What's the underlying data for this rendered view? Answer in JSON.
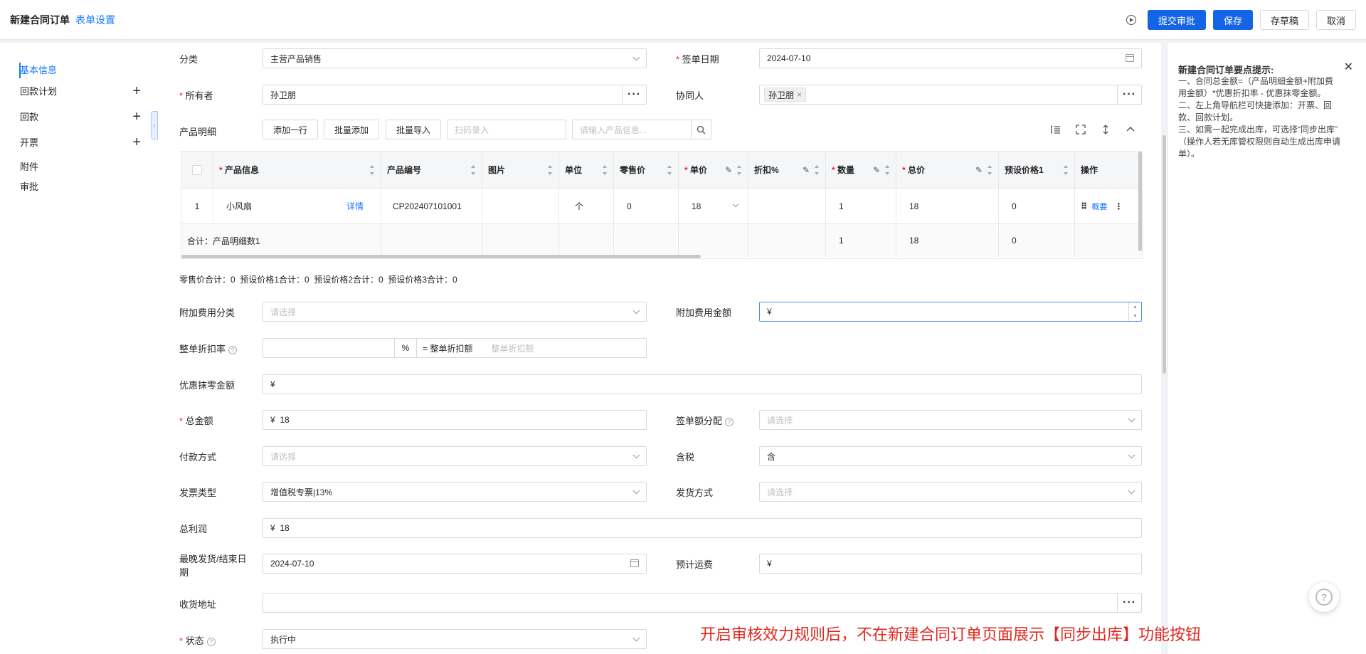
{
  "header": {
    "title": "新建合同订单",
    "form_setting": "表单设置",
    "buttons": {
      "submit": "提交审批",
      "save": "保存",
      "draft": "存草稿",
      "cancel": "取消"
    }
  },
  "nav": {
    "items": [
      {
        "label": "基本信息"
      },
      {
        "label": "回款计划"
      },
      {
        "label": "回款"
      },
      {
        "label": "开票"
      },
      {
        "label": "附件"
      },
      {
        "label": "审批"
      }
    ]
  },
  "form": {
    "category": {
      "label": "分类",
      "value": "主营产品销售"
    },
    "sign_date": {
      "label": "签单日期",
      "value": "2024-07-10"
    },
    "owner": {
      "label": "所有者",
      "value": "孙卫朋"
    },
    "collaborator": {
      "label": "协同人",
      "tag": "孙卫朋"
    },
    "product_detail": {
      "label": "产品明细",
      "add_row": "添加一行",
      "batch_add": "批量添加",
      "batch_import": "批量导入",
      "scan_placeholder": "扫码录入",
      "search_placeholder": "请输入产品信息..."
    },
    "table": {
      "headers": [
        "产品信息",
        "产品编号",
        "图片",
        "单位",
        "零售价",
        "单价",
        "折扣%",
        "数量",
        "总价",
        "预设价格1",
        "操作"
      ],
      "row": {
        "index": "1",
        "product": "小风扇",
        "detail_link": "详情",
        "code": "CP202407101001",
        "image": "",
        "unit": "个",
        "retail": "0",
        "price": "18",
        "discount": "",
        "qty": "1",
        "total": "18",
        "preset1": "0",
        "op_link": "概要"
      },
      "summary": {
        "label": "合计：产品明细数1",
        "qty": "1",
        "total": "18",
        "preset1": "0"
      }
    },
    "totals_line": "零售价合计：0  预设价格1合计：0  预设价格2合计：0  预设价格3合计：0",
    "extra_fee_category": {
      "label": "附加费用分类",
      "placeholder": "请选择"
    },
    "extra_fee_amount": {
      "label": "附加费用金额",
      "value": "¥"
    },
    "discount_rate": {
      "label": "整单折扣率",
      "unit": "%",
      "eq_label": "= 整单折扣额",
      "placeholder": "整单折扣额"
    },
    "rounding": {
      "label": "优惠抹零金额",
      "value": "¥"
    },
    "total_amount": {
      "label": "总金额",
      "value": "¥  18"
    },
    "sign_alloc": {
      "label": "签单额分配",
      "placeholder": "请选择"
    },
    "payment_method": {
      "label": "付款方式",
      "placeholder": "请选择"
    },
    "tax": {
      "label": "含税",
      "value": "含"
    },
    "invoice_type": {
      "label": "发票类型",
      "value": "增值税专票|13%"
    },
    "delivery_method": {
      "label": "发货方式",
      "placeholder": "请选择"
    },
    "gross_profit": {
      "label": "总利润",
      "value": "¥  18"
    },
    "latest_delivery": {
      "label_1": "最晚发货/结束日",
      "label_2": "期",
      "value": "2024-07-10"
    },
    "est_freight": {
      "label": "预计运费",
      "value": "¥"
    },
    "address": {
      "label": "收货地址",
      "value": ""
    },
    "status": {
      "label": "状态",
      "value": "执行中"
    }
  },
  "tips": {
    "title": "新建合同订单要点提示:",
    "lines": [
      "一、合同总金额=（产品明细金额+附加费",
      "用金额）*优惠折扣率 - 优惠抹零金额。",
      "二、左上角导航栏可快捷添加：开票、回",
      "款、回款计划。",
      "三、如需一起完成出库，可选择“同步出库”",
      "（操作人若无库管权限则自动生成出库申请",
      "单）。"
    ]
  },
  "annotation": "开启审核效力规则后，不在新建合同订单页面展示【同步出库】功能按钮",
  "icons": [
    "play-circle-icon",
    "plus-icon",
    "chevron-down-icon",
    "calendar-icon",
    "more-icon",
    "search-icon",
    "close-icon",
    "help-icon",
    "pencil-icon",
    "sort-icon",
    "drag-icon",
    "fullscreen-icon",
    "line-height-icon",
    "collapse-up-icon"
  ],
  "colors": {
    "primary": "#1464e6",
    "link": "#1677ff",
    "required": "#f5222d",
    "annotation": "#e0271f"
  }
}
